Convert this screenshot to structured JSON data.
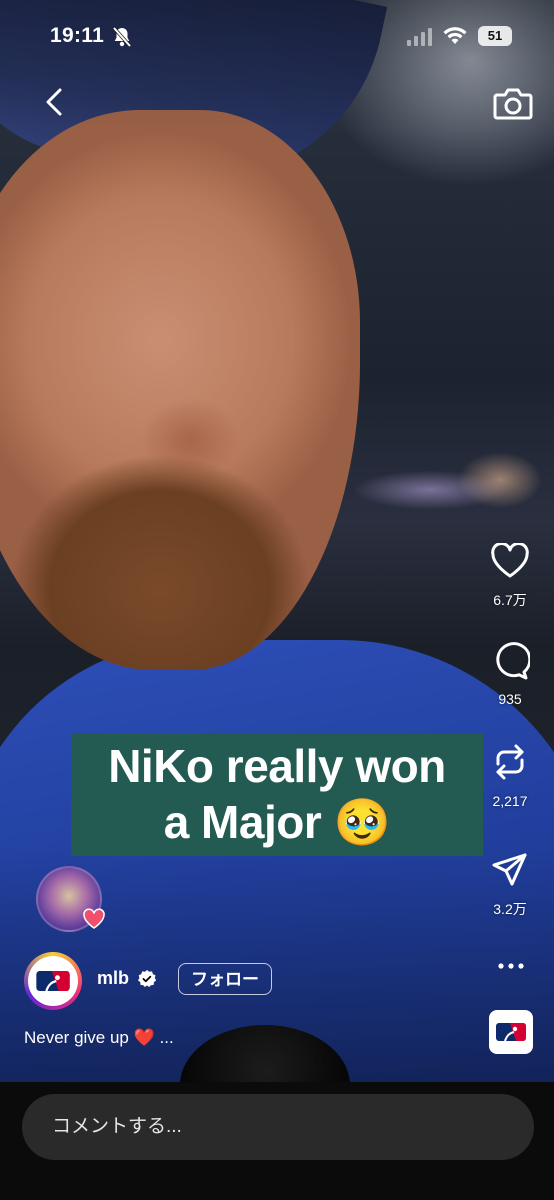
{
  "status_bar": {
    "time": "19:11",
    "battery": "51"
  },
  "video": {
    "caption_line1": "NiKo really won",
    "caption_line2": "a Major 🥹"
  },
  "actions": {
    "likes": "6.7万",
    "comments": "935",
    "reposts": "2,217",
    "shares": "3.2万"
  },
  "account": {
    "username": "mlb",
    "follow_label": "フォロー",
    "description": "Never give up ❤️ ..."
  },
  "comment_bar": {
    "placeholder": "コメントする..."
  }
}
